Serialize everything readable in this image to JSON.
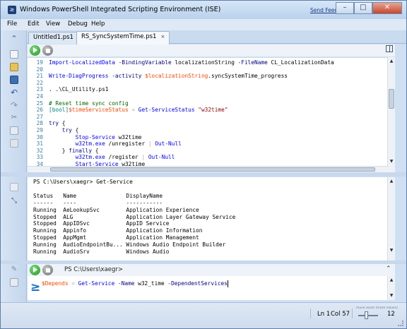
{
  "window": {
    "title": "Windows PowerShell Integrated Scripting Environment (ISE)",
    "send_feedback": "Send Feedback",
    "controls": {
      "minimize": "–",
      "maximize": "□",
      "close": "✕"
    }
  },
  "menu": [
    "File",
    "Edit",
    "View",
    "Debug",
    "Help"
  ],
  "tabs": [
    {
      "label": "Untitled1.ps1",
      "active": false
    },
    {
      "label": "RS_SyncSystemTime.ps1",
      "active": true,
      "close": "×"
    }
  ],
  "editor": {
    "lines": [
      {
        "n": "19",
        "segs": [
          [
            "cmd",
            "Import-LocalizedData"
          ],
          [
            "param",
            " -BindingVariable "
          ],
          [
            "plain",
            "localizationString"
          ],
          [
            "param",
            " -FileName "
          ],
          [
            "plain",
            "CL_LocalizationData"
          ]
        ]
      },
      {
        "n": "20",
        "segs": []
      },
      {
        "n": "21",
        "segs": [
          [
            "cmd",
            "Write-DiagProgress"
          ],
          [
            "param",
            " -activity "
          ],
          [
            "var",
            "$localizationString"
          ],
          [
            "plain",
            ".syncSystemTime_progress"
          ]
        ]
      },
      {
        "n": "22",
        "segs": []
      },
      {
        "n": "23",
        "segs": [
          [
            "plain",
            ". "
          ],
          [
            "plain",
            ".\\CL_Utility.ps1"
          ]
        ]
      },
      {
        "n": "24",
        "segs": []
      },
      {
        "n": "25",
        "segs": [
          [
            "cmt",
            "# Reset time sync config"
          ]
        ]
      },
      {
        "n": "26",
        "segs": [
          [
            "type",
            "[bool]"
          ],
          [
            "var",
            "$timeServiceStatus"
          ],
          [
            "op",
            " = "
          ],
          [
            "cmd",
            "Get-ServiceStatus"
          ],
          [
            "str",
            " \"w32time\""
          ]
        ]
      },
      {
        "n": "27",
        "segs": []
      },
      {
        "n": "28",
        "segs": [
          [
            "key",
            "try"
          ],
          [
            "plain",
            " {"
          ]
        ]
      },
      {
        "n": "29",
        "segs": [
          [
            "plain",
            "    "
          ],
          [
            "key",
            "try"
          ],
          [
            "plain",
            " {"
          ]
        ]
      },
      {
        "n": "30",
        "segs": [
          [
            "plain",
            "        "
          ],
          [
            "cmd",
            "Stop-Service"
          ],
          [
            "plain",
            " w32time"
          ]
        ]
      },
      {
        "n": "31",
        "segs": [
          [
            "plain",
            "        "
          ],
          [
            "cmd",
            "w32tm.exe"
          ],
          [
            "plain",
            " /unregister "
          ],
          [
            "op",
            "|"
          ],
          [
            "cmd",
            " Out-Null"
          ]
        ]
      },
      {
        "n": "32",
        "segs": [
          [
            "plain",
            "    } "
          ],
          [
            "key",
            "finally"
          ],
          [
            "plain",
            " {"
          ]
        ]
      },
      {
        "n": "33",
        "segs": [
          [
            "plain",
            "        "
          ],
          [
            "cmd",
            "w32tm.exe"
          ],
          [
            "plain",
            " /register "
          ],
          [
            "op",
            "|"
          ],
          [
            "cmd",
            " Out-Null"
          ]
        ]
      },
      {
        "n": "34",
        "segs": [
          [
            "plain",
            "        "
          ],
          [
            "cmd",
            "Start-Service"
          ],
          [
            "plain",
            " w32time"
          ]
        ]
      }
    ]
  },
  "output": {
    "lines": [
      "PS C:\\Users\\xaegr> Get-Service",
      "",
      "Status   Name               DisplayName",
      "------   ----               -----------",
      "Running  AeLookupSvc        Application Experience",
      "Stopped  ALG                Application Layer Gateway Service",
      "Stopped  AppIDSvc           AppID Service",
      "Running  Appinfo            Application Information",
      "Stopped  AppMgmt            Application Management",
      "Running  AudioEndpointBu... Windows Audio Endpoint Builder",
      "Running  AudioSrv           Windows Audio"
    ]
  },
  "command_pane": {
    "prompt": "PS C:\\Users\\xaegr>",
    "logo": "≥",
    "segs": [
      [
        "var",
        "$Depends"
      ],
      [
        "op",
        " = "
      ],
      [
        "cmd",
        "Get-Service"
      ],
      [
        "param",
        " -Name "
      ],
      [
        "plain",
        "w32_time"
      ],
      [
        "param",
        " -DependentServices"
      ]
    ]
  },
  "status": {
    "ln": "Ln 1",
    "col": "Col 57",
    "zoom_value": "12",
    "zoom_caption": "move zoom (more values)"
  },
  "icons": [
    "new-file-icon",
    "open-file-icon",
    "save-icon",
    "undo-icon",
    "redo-icon",
    "cut-icon",
    "copy-icon",
    "paste-icon",
    "clear-output-icon",
    "run-icon",
    "stop-icon",
    "split-view-icon",
    "collapse-icon",
    "powershell-logo-icon"
  ],
  "colors": {
    "cmd": "#0000ff",
    "var": "#ff4500",
    "string": "#8b0000",
    "comment": "#006400",
    "type": "#008080",
    "line_number": "#3a7ea1"
  }
}
